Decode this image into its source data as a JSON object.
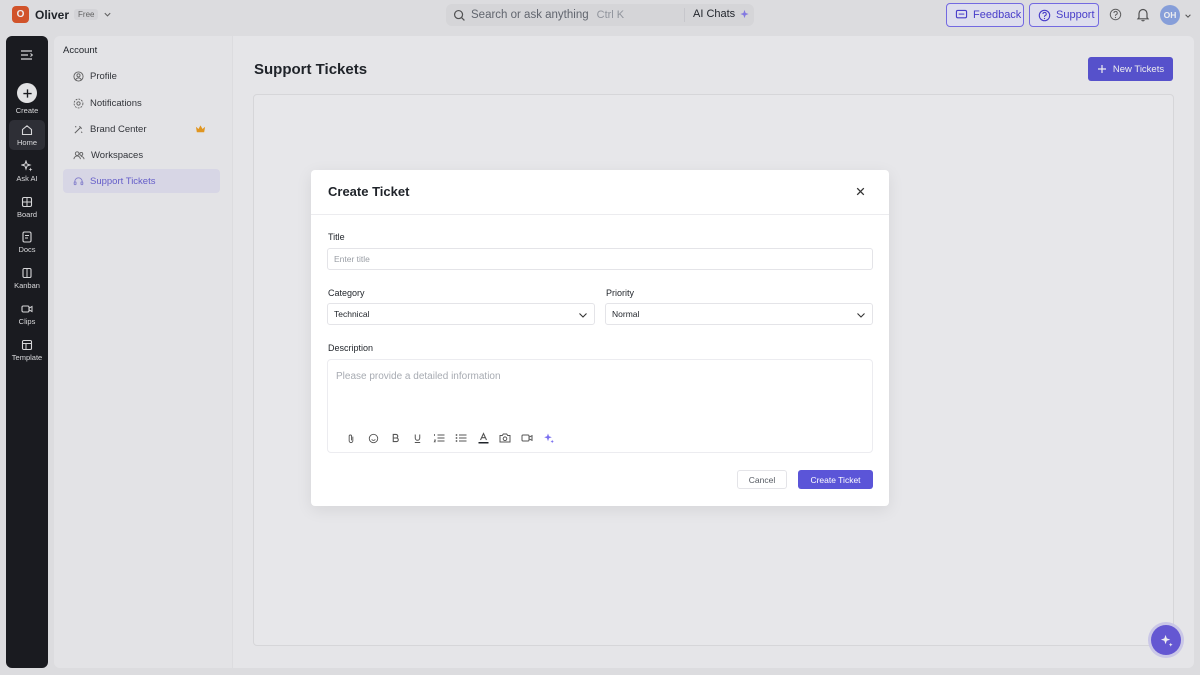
{
  "topbar": {
    "workspace_initial": "O",
    "workspace_name": "Oliver",
    "plan": "Free",
    "search_placeholder": "Search or ask anything",
    "search_shortcut": "Ctrl K",
    "ai_chats_label": "AI Chats",
    "feedback_label": "Feedback",
    "support_label": "Support",
    "avatar_initials": "OH"
  },
  "rail": {
    "create_label": "Create",
    "items": [
      {
        "label": "Home",
        "icon": "home-icon"
      },
      {
        "label": "Ask AI",
        "icon": "sparkle-icon"
      },
      {
        "label": "Board",
        "icon": "board-icon"
      },
      {
        "label": "Docs",
        "icon": "docs-icon"
      },
      {
        "label": "Kanban",
        "icon": "kanban-icon"
      },
      {
        "label": "Clips",
        "icon": "clips-icon"
      },
      {
        "label": "Template",
        "icon": "template-icon"
      }
    ],
    "active": "Home"
  },
  "sidebar": {
    "heading": "Account",
    "items": [
      {
        "label": "Profile",
        "icon": "user-circle-icon"
      },
      {
        "label": "Notifications",
        "icon": "notification-icon"
      },
      {
        "label": "Brand Center",
        "icon": "brand-icon"
      },
      {
        "label": "Workspaces",
        "icon": "users-icon"
      },
      {
        "label": "Support Tickets",
        "icon": "headset-icon"
      }
    ],
    "active": "Support Tickets"
  },
  "main": {
    "title": "Support Tickets",
    "new_button": "New Tickets"
  },
  "modal": {
    "title": "Create Ticket",
    "title_label": "Title",
    "title_placeholder": "Enter title",
    "category_label": "Category",
    "category_value": "Technical",
    "priority_label": "Priority",
    "priority_value": "Normal",
    "description_label": "Description",
    "description_placeholder": "Please provide a detailed information",
    "cancel_label": "Cancel",
    "create_label": "Create Ticket"
  },
  "colors": {
    "accent": "#5b55d8",
    "rail_bg": "#1a1b1f",
    "active_bg": "#e6e5f5",
    "crown": "#f0a020"
  }
}
